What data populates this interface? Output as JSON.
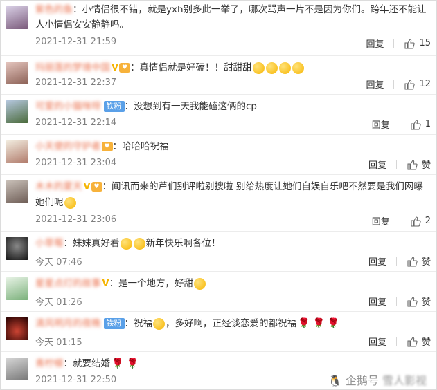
{
  "comments": [
    {
      "user": "紫色的鱼",
      "text": "：小情侣很不错，就是yxh别多此一举了，哪次骂声一片不是因为你们。跨年还不能让人小情侣安安静静吗。",
      "time": "2021-12-31 21:59",
      "reply": "回复",
      "likes": "15"
    },
    {
      "user": "玛丽莲的梦境中国",
      "text": "：真情侣就是好磕！！甜甜甜",
      "time": "2021-12-31 22:37",
      "reply": "回复",
      "likes": "12"
    },
    {
      "user": "可爱的小猫咪呀",
      "badge": "铁粉",
      "text": "：没想到有一天我能磕这俩的cp",
      "time": "2021-12-31 22:14",
      "reply": "回复",
      "likes": "1"
    },
    {
      "user": "小天使的守护者",
      "text": "：哈哈哈祝福",
      "time": "2021-12-31 23:04",
      "reply": "回复",
      "likes": "赞"
    },
    {
      "user": "木木的夏天",
      "text": "：闻讯而来的芦们别评啦别搜啦 别给热度让她们自娱自乐吧不然要是我们网曝她们呢",
      "time": "2021-12-31 23:06",
      "reply": "回复",
      "likes": "2"
    },
    {
      "user": "小草莓",
      "text": "：妹妹真好看",
      "text2": "新年快乐啊各位！",
      "time": "今天 07:46",
      "reply": "回复",
      "likes": "赞"
    },
    {
      "user": "星星点灯的故事",
      "text": "：是一个地方，好甜",
      "time": "今天 01:26",
      "reply": "回复",
      "likes": "赞"
    },
    {
      "user": "清风明月的夜晚",
      "badge": "铁粉",
      "text": "：祝福",
      "text2": "，多好啊，正经谈恋爱的都祝福",
      "time": "今天 01:15",
      "reply": "回复",
      "likes": "赞"
    },
    {
      "user": "青柠檬",
      "text": "：就要结婚",
      "time": "2021-12-31 22:50",
      "reply": "回复",
      "likes": ""
    }
  ],
  "watermark": {
    "brand": "企鹅号",
    "author": "雪人影视"
  },
  "colors": {
    "username": "#eb7350",
    "time": "#808080",
    "badge_fan": "#5aa0e8",
    "rose": "#d8242a"
  }
}
